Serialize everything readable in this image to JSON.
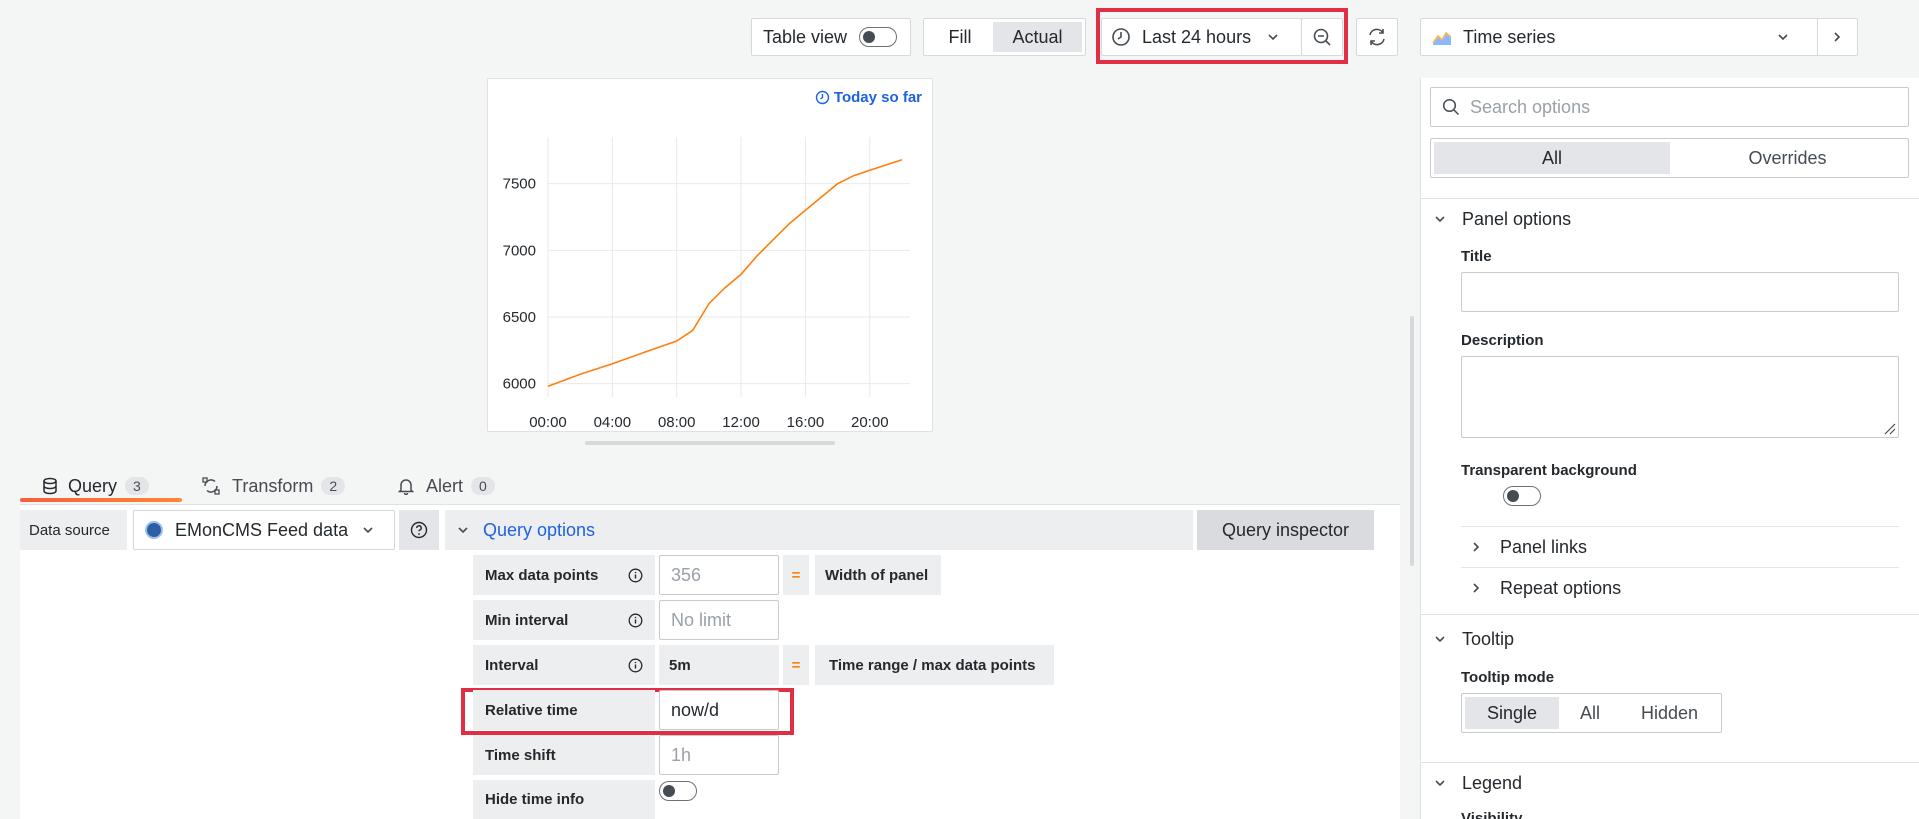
{
  "toolbar": {
    "table_view_label": "Table view",
    "fill_label": "Fill",
    "actual_label": "Actual",
    "time_range_label": "Last 24 hours",
    "visualization_label": "Time series"
  },
  "panel": {
    "time_info": "Today so far"
  },
  "chart_data": {
    "type": "line",
    "x": [
      "00:00",
      "02:00",
      "04:00",
      "06:00",
      "08:00",
      "09:00",
      "10:00",
      "11:00",
      "12:00",
      "13:00",
      "14:00",
      "15:00",
      "16:00",
      "17:00",
      "18:00",
      "19:00",
      "20:00",
      "21:00",
      "22:00"
    ],
    "values": [
      5980,
      6070,
      6150,
      6235,
      6320,
      6400,
      6600,
      6720,
      6820,
      6960,
      7080,
      7200,
      7300,
      7400,
      7500,
      7560,
      7600,
      7640,
      7680
    ],
    "x_ticks": [
      "00:00",
      "04:00",
      "08:00",
      "12:00",
      "16:00",
      "20:00"
    ],
    "y_ticks": [
      6000,
      6500,
      7000,
      7500
    ],
    "ylim": [
      5900,
      7850
    ],
    "series_color": "#ff7f0e",
    "grid": true,
    "legend": "none"
  },
  "tabs": {
    "query": {
      "label": "Query",
      "count": "3"
    },
    "transform": {
      "label": "Transform",
      "count": "2"
    },
    "alert": {
      "label": "Alert",
      "count": "0"
    }
  },
  "datasource": {
    "label": "Data source",
    "value": "EMonCMS Feed data"
  },
  "query_options": {
    "title": "Query options",
    "inspector_label": "Query inspector",
    "max_data_points": {
      "label": "Max data points",
      "placeholder": "356",
      "equals": "=",
      "note": "Width of panel"
    },
    "min_interval": {
      "label": "Min interval",
      "placeholder": "No limit"
    },
    "interval": {
      "label": "Interval",
      "value": "5m",
      "equals": "=",
      "note": "Time range / max data points"
    },
    "relative_time": {
      "label": "Relative time",
      "value": "now/d"
    },
    "time_shift": {
      "label": "Time shift",
      "placeholder": "1h"
    },
    "hide_time_info": {
      "label": "Hide time info"
    }
  },
  "options_pane": {
    "search_placeholder": "Search options",
    "all_tab": "All",
    "overrides_tab": "Overrides",
    "panel_options": "Panel options",
    "title_label": "Title",
    "description_label": "Description",
    "transparent_label": "Transparent background",
    "panel_links": "Panel links",
    "repeat_options": "Repeat options",
    "tooltip": "Tooltip",
    "tooltip_mode_label": "Tooltip mode",
    "tooltip_modes": [
      "Single",
      "All",
      "Hidden"
    ],
    "legend": "Legend",
    "visibility": "Visibility"
  }
}
